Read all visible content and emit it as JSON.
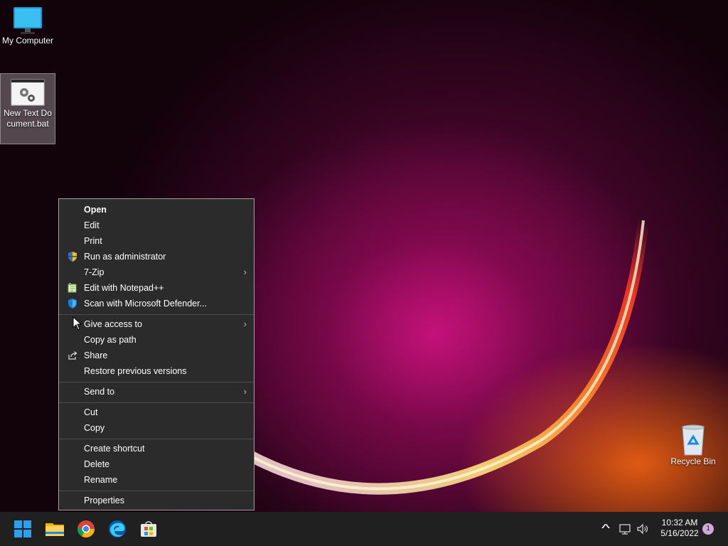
{
  "desktop": {
    "icons": [
      {
        "label": "My Computer",
        "icon": "monitor-icon"
      },
      {
        "label": "New Text Document.bat",
        "icon": "batch-file-icon"
      },
      {
        "label": "Recycle Bin",
        "icon": "recycle-bin-icon"
      }
    ]
  },
  "context_menu": {
    "items": [
      {
        "label": "Open"
      },
      {
        "label": "Edit"
      },
      {
        "label": "Print"
      },
      {
        "label": "Run as administrator",
        "icon": "uac-shield-icon"
      },
      {
        "label": "7-Zip",
        "submenu": true
      },
      {
        "label": "Edit with Notepad++",
        "icon": "notepadpp-icon"
      },
      {
        "label": "Scan with Microsoft Defender...",
        "icon": "defender-icon"
      },
      {
        "label": "Give access to",
        "submenu": true
      },
      {
        "label": "Copy as path"
      },
      {
        "label": "Share",
        "icon": "share-icon"
      },
      {
        "label": "Restore previous versions"
      },
      {
        "label": "Send to",
        "submenu": true
      },
      {
        "label": "Cut"
      },
      {
        "label": "Copy"
      },
      {
        "label": "Create shortcut"
      },
      {
        "label": "Delete"
      },
      {
        "label": "Rename"
      },
      {
        "label": "Properties"
      }
    ],
    "chevron": "›"
  },
  "taskbar": {
    "apps": [
      "start-icon",
      "file-explorer-icon",
      "chrome-icon",
      "edge-icon",
      "store-icon"
    ],
    "tray": {
      "time": "10:32 AM",
      "date": "5/16/2022",
      "notifications": "1",
      "overflow_glyph": "^"
    }
  },
  "colors": {
    "menu_bg": "#2b2b2b",
    "taskbar_bg": "#202020",
    "accent": "#0078d4"
  }
}
